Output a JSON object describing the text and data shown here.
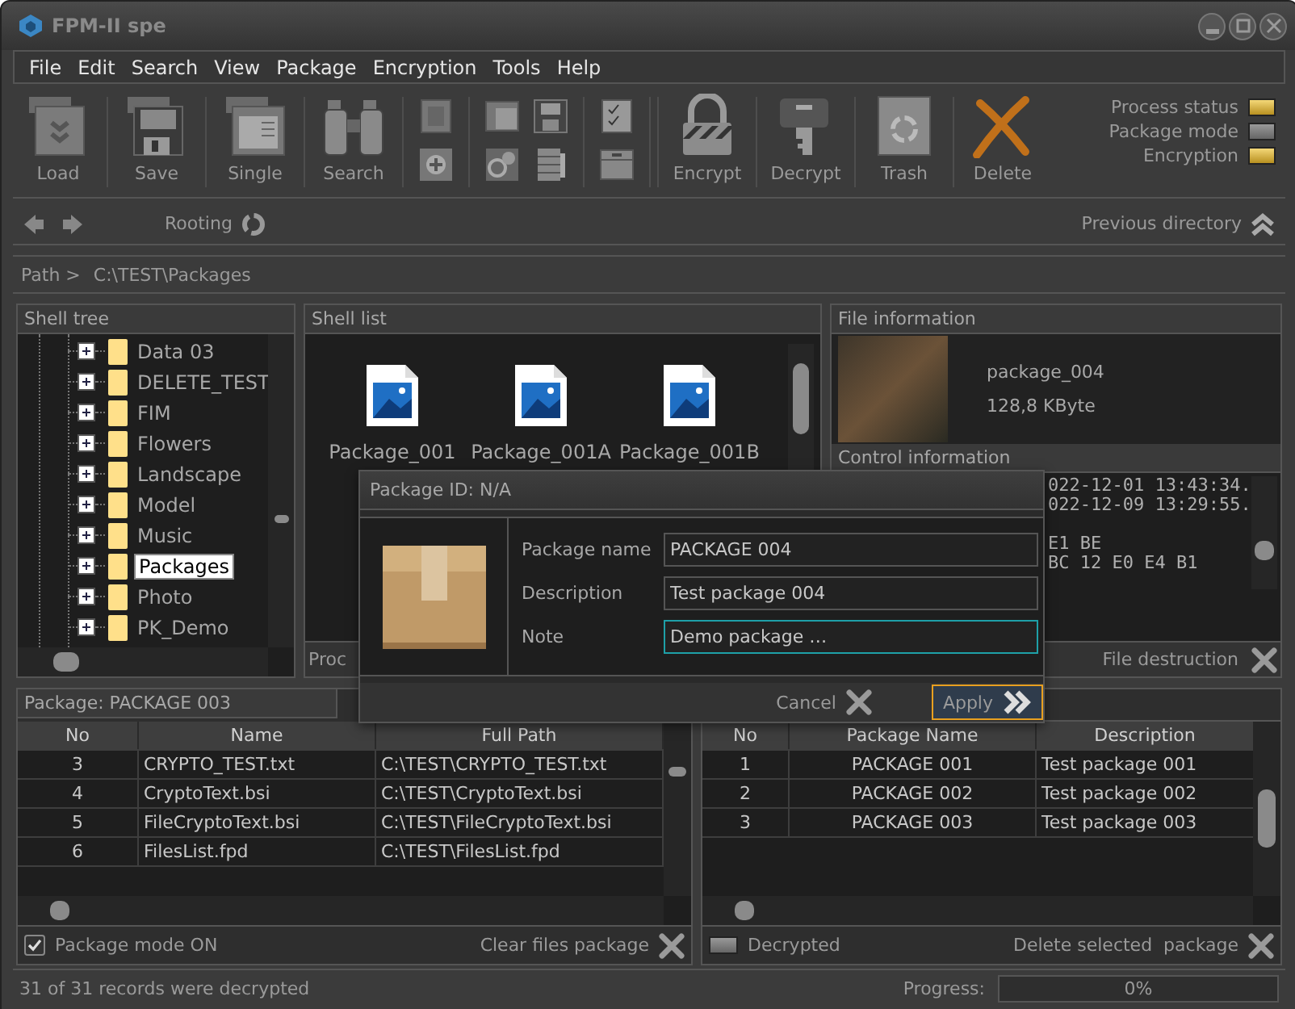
{
  "window": {
    "title": "FPM-II spe"
  },
  "menu": [
    "File",
    "Edit",
    "Search",
    "View",
    "Package",
    "Encryption",
    "Tools",
    "Help"
  ],
  "toolbar": {
    "buttons": [
      {
        "label": "Load",
        "kind": "load"
      },
      {
        "label": "Save",
        "kind": "save"
      },
      {
        "label": "Single",
        "kind": "single"
      },
      {
        "label": "Search",
        "kind": "search"
      },
      {
        "label": "Encrypt",
        "kind": "encrypt"
      },
      {
        "label": "Decrypt",
        "kind": "decrypt"
      },
      {
        "label": "Trash",
        "kind": "trash"
      },
      {
        "label": "Delete",
        "kind": "delete"
      }
    ],
    "indicators": [
      {
        "label": "Process status",
        "on": true
      },
      {
        "label": "Package mode",
        "on": false
      },
      {
        "label": "Encryption",
        "on": true
      }
    ]
  },
  "navigation": {
    "rooting": "Rooting",
    "previous": "Previous directory"
  },
  "path": {
    "label": "Path >",
    "value": "C:\\TEST\\Packages"
  },
  "shell_tree": {
    "title": "Shell tree",
    "items": [
      {
        "label": "Data 03",
        "selected": false,
        "expanded": false
      },
      {
        "label": "DELETE_TEST",
        "selected": false,
        "expanded": false
      },
      {
        "label": "FIM",
        "selected": false,
        "expanded": false
      },
      {
        "label": "Flowers",
        "selected": false,
        "expanded": false
      },
      {
        "label": "Landscape",
        "selected": false,
        "expanded": false
      },
      {
        "label": "Model",
        "selected": false,
        "expanded": false
      },
      {
        "label": "Music",
        "selected": false,
        "expanded": false
      },
      {
        "label": "Packages",
        "selected": true,
        "expanded": false
      },
      {
        "label": "Photo",
        "selected": false,
        "expanded": false
      },
      {
        "label": "PK_Demo",
        "selected": false,
        "expanded": false
      }
    ]
  },
  "shell_list": {
    "title": "Shell list",
    "items": [
      "Package_001",
      "Package_001A",
      "Package_001B"
    ],
    "status": "Proc"
  },
  "file_information": {
    "title": "File information",
    "name": "package_004",
    "size": "128,8 KByte"
  },
  "control_information": {
    "title": "Control information",
    "line_groups": [
      [
        "022-12-01 13:43:34.",
        "022-12-09 13:29:55."
      ],
      [
        "E1 BE",
        "BC 12 E0 E4 B1"
      ]
    ],
    "action": "File destruction"
  },
  "package_dialog": {
    "title": "Package ID: N/A",
    "fields": [
      {
        "label": "Package name",
        "value": "PACKAGE 004",
        "focused": false
      },
      {
        "label": "Description",
        "value": "Test package 004",
        "focused": false
      },
      {
        "label": "Note",
        "value": "Demo package …",
        "focused": true
      }
    ],
    "buttons": [
      {
        "label": "Cancel",
        "kind": "cancel",
        "focused": false
      },
      {
        "label": "Apply",
        "kind": "apply",
        "focused": true
      }
    ]
  },
  "files_package": {
    "title": "Package: PACKAGE 003",
    "columns": [
      "No",
      "Name",
      "Full Path"
    ],
    "rows": [
      [
        "3",
        "CRYPTO_TEST.txt",
        "C:\\TEST\\CRYPTO_TEST.txt"
      ],
      [
        "4",
        "CryptoText.bsi",
        "C:\\TEST\\CryptoText.bsi"
      ],
      [
        "5",
        "FileCryptoText.bsi",
        "C:\\TEST\\FileCryptoText.bsi"
      ],
      [
        "6",
        "FilesList.fpd",
        "C:\\TEST\\FilesList.fpd"
      ]
    ],
    "mode": {
      "label": "Package mode ON",
      "checked": true
    },
    "action": "Clear files package"
  },
  "packages": {
    "columns": [
      "No",
      "Package Name",
      "Description"
    ],
    "rows": [
      [
        "1",
        "PACKAGE 001",
        "Test package 001"
      ],
      [
        "2",
        "PACKAGE 002",
        "Test package 002"
      ],
      [
        "3",
        "PACKAGE 003",
        "Test package 003"
      ]
    ],
    "decrypted": {
      "label": "Decrypted",
      "on": false
    },
    "action": "Delete selected  package"
  },
  "status_bar": {
    "message": "31 of 31 records were decrypted",
    "progress_label": "Progress:",
    "progress": {
      "level": 0,
      "reading": "0%"
    }
  }
}
